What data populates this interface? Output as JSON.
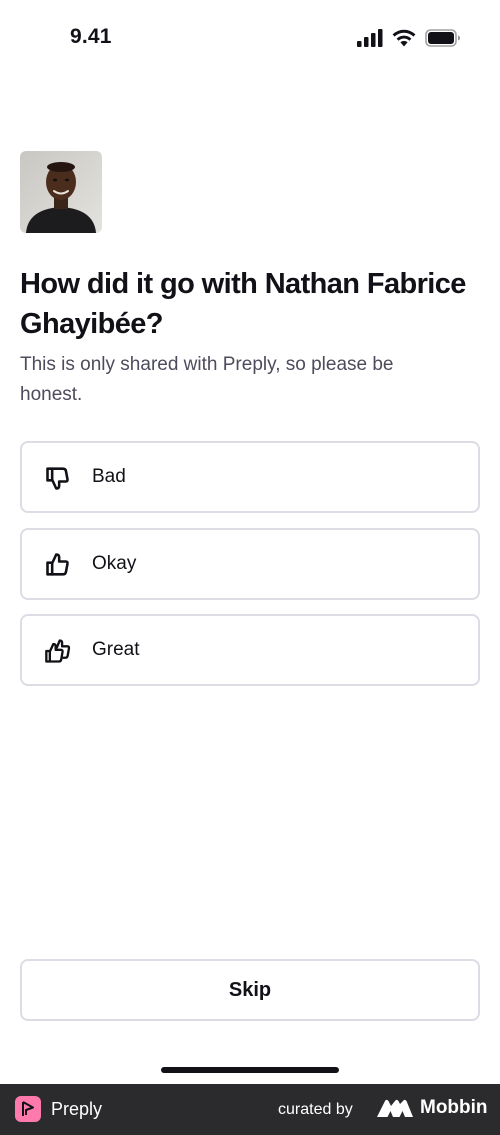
{
  "status_bar": {
    "time": "9.41",
    "icons": [
      "signal-icon",
      "wifi-icon",
      "battery-icon"
    ]
  },
  "tutor": {
    "avatar": "tutor-avatar"
  },
  "question": {
    "title": "How did it go with Nathan Fabrice Ghayibée?",
    "subtitle": "This is only shared with Preply, so please be honest."
  },
  "options": [
    {
      "label": "Bad",
      "icon": "thumbs-down-icon"
    },
    {
      "label": "Okay",
      "icon": "thumbs-up-icon"
    },
    {
      "label": "Great",
      "icon": "double-thumbs-up-icon"
    }
  ],
  "actions": {
    "skip_label": "Skip"
  },
  "footer": {
    "brand_name": "Preply",
    "curated_by": "curated by",
    "mobbin_name": "Mobbin"
  },
  "colors": {
    "text_primary": "#121117",
    "text_secondary": "#4d4c5c",
    "border": "#dcdce5",
    "footer_bg": "#2b2b2d",
    "preply_pink": "#ff7aac"
  }
}
